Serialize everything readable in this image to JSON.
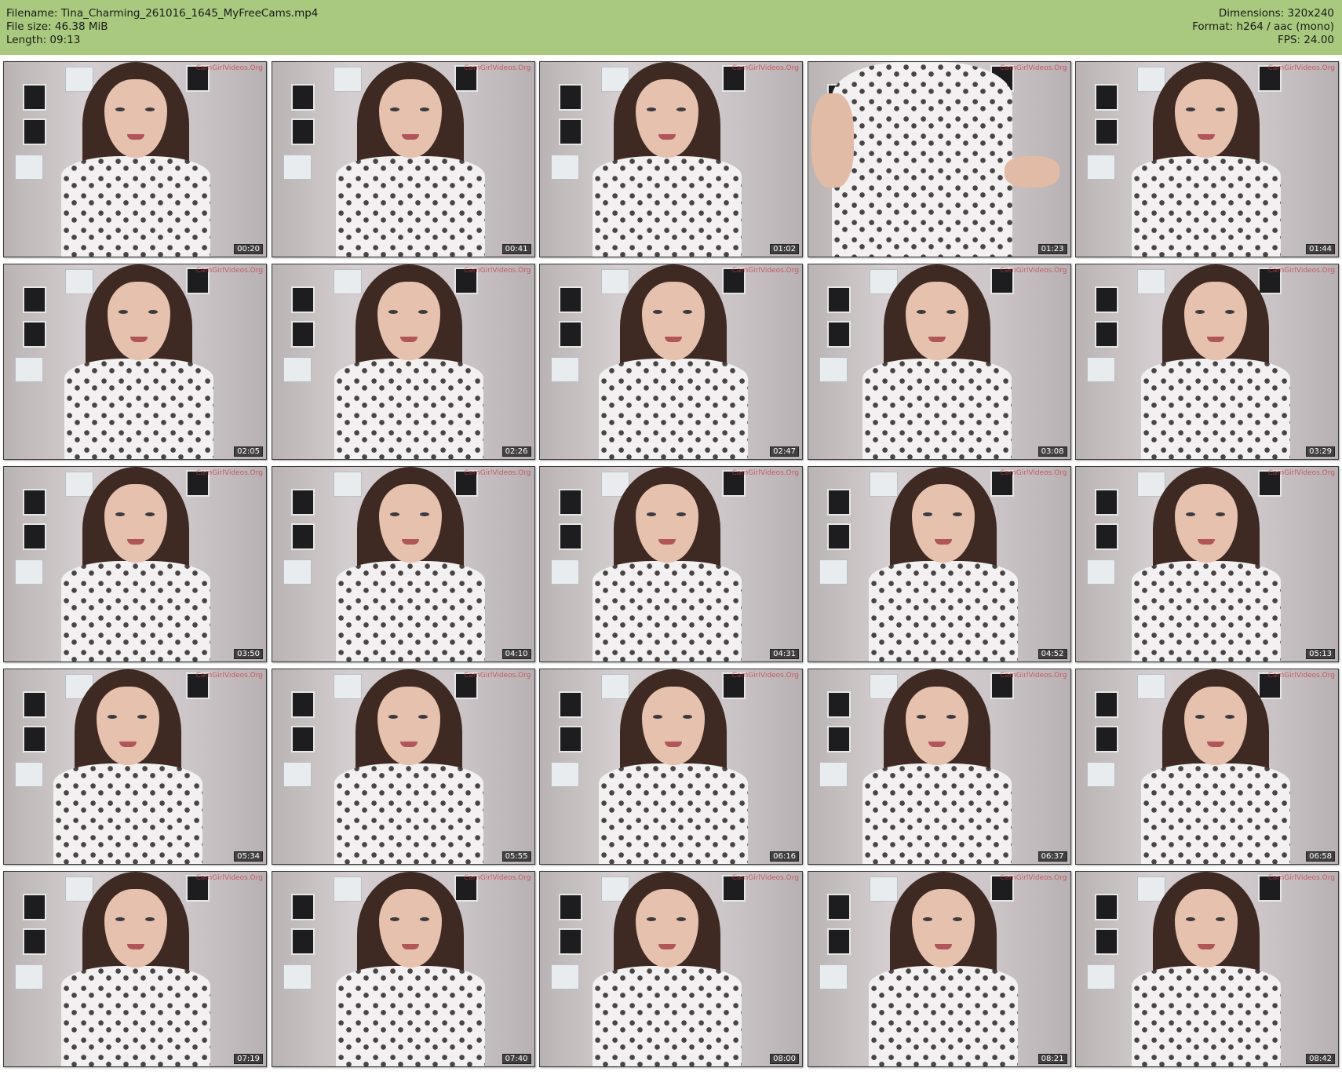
{
  "header": {
    "filename_line": "Filename: Tina_Charming_261016_1645_MyFreeCams.mp4",
    "filesize_line": "File size: 46.38 MiB",
    "length_line": "Length: 09:13",
    "dimensions_line": "Dimensions: 320x240",
    "format_line": "Format: h264 / aac (mono)",
    "fps_line": "FPS: 24.00",
    "background_color": "#a8c97e"
  },
  "watermark_text": "CamGirlVideos.Org",
  "thumbnails": [
    {
      "timestamp": "00:20"
    },
    {
      "timestamp": "00:41"
    },
    {
      "timestamp": "01:02"
    },
    {
      "timestamp": "01:23"
    },
    {
      "timestamp": "01:44"
    },
    {
      "timestamp": "02:05"
    },
    {
      "timestamp": "02:26"
    },
    {
      "timestamp": "02:47"
    },
    {
      "timestamp": "03:08"
    },
    {
      "timestamp": "03:29"
    },
    {
      "timestamp": "03:50"
    },
    {
      "timestamp": "04:10"
    },
    {
      "timestamp": "04:31"
    },
    {
      "timestamp": "04:52"
    },
    {
      "timestamp": "05:13"
    },
    {
      "timestamp": "05:34"
    },
    {
      "timestamp": "05:55"
    },
    {
      "timestamp": "06:16"
    },
    {
      "timestamp": "06:37"
    },
    {
      "timestamp": "06:58"
    },
    {
      "timestamp": "07:19"
    },
    {
      "timestamp": "07:40"
    },
    {
      "timestamp": "08:00"
    },
    {
      "timestamp": "08:21"
    },
    {
      "timestamp": "08:42"
    }
  ]
}
